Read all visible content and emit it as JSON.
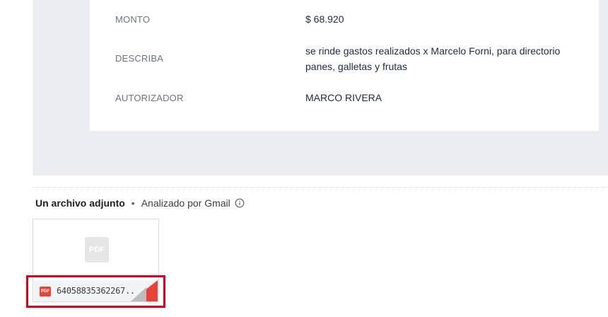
{
  "fields": [
    {
      "label": "MONTO",
      "value": "$ 68.920"
    },
    {
      "label": "DESCRIBA",
      "value": "se rinde gastos realizados x Marcelo Forni, para directorio panes, galletas y frutas"
    },
    {
      "label": "AUTORIZADOR",
      "value": "MARCO RIVERA"
    }
  ],
  "attachments": {
    "title": "Un archivo adjunto",
    "separator": "•",
    "scanned_by": "Analizado por Gmail",
    "info_icon": "info-icon",
    "file": {
      "thumb_label": "PDF",
      "badge_label": "PDF",
      "name": "64058835362267...",
      "icon": "pdf-icon"
    }
  },
  "colors": {
    "email_background": "#ecedf0",
    "label_text": "#6b7384",
    "value_text": "#1f2a44",
    "pdf_red": "#ea4335",
    "highlight": "#e2001a"
  }
}
